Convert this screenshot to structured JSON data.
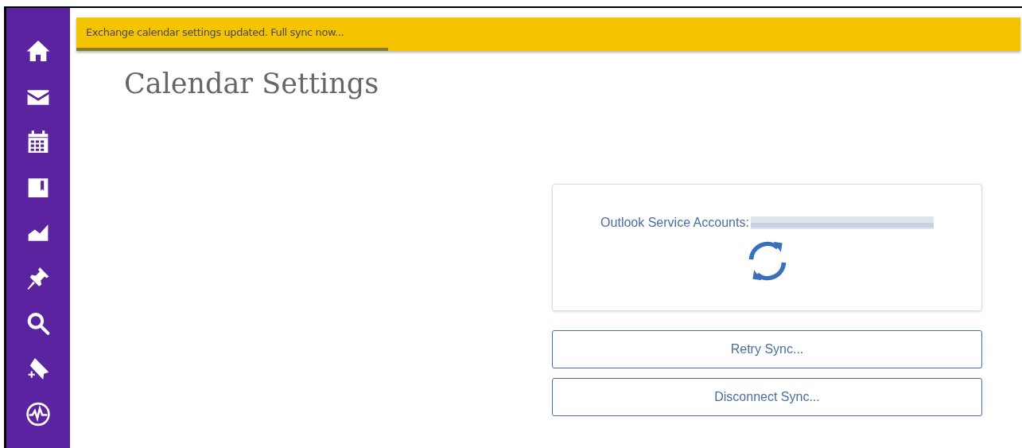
{
  "toast": {
    "message": "Exchange calendar settings updated. Full sync now...",
    "level": 0.33
  },
  "page": {
    "title": "Calendar Settings"
  },
  "account_card": {
    "label": "Outlook Service Accounts:"
  },
  "buttons": [
    "Retry Sync...",
    "Disconnect Sync..."
  ]
}
